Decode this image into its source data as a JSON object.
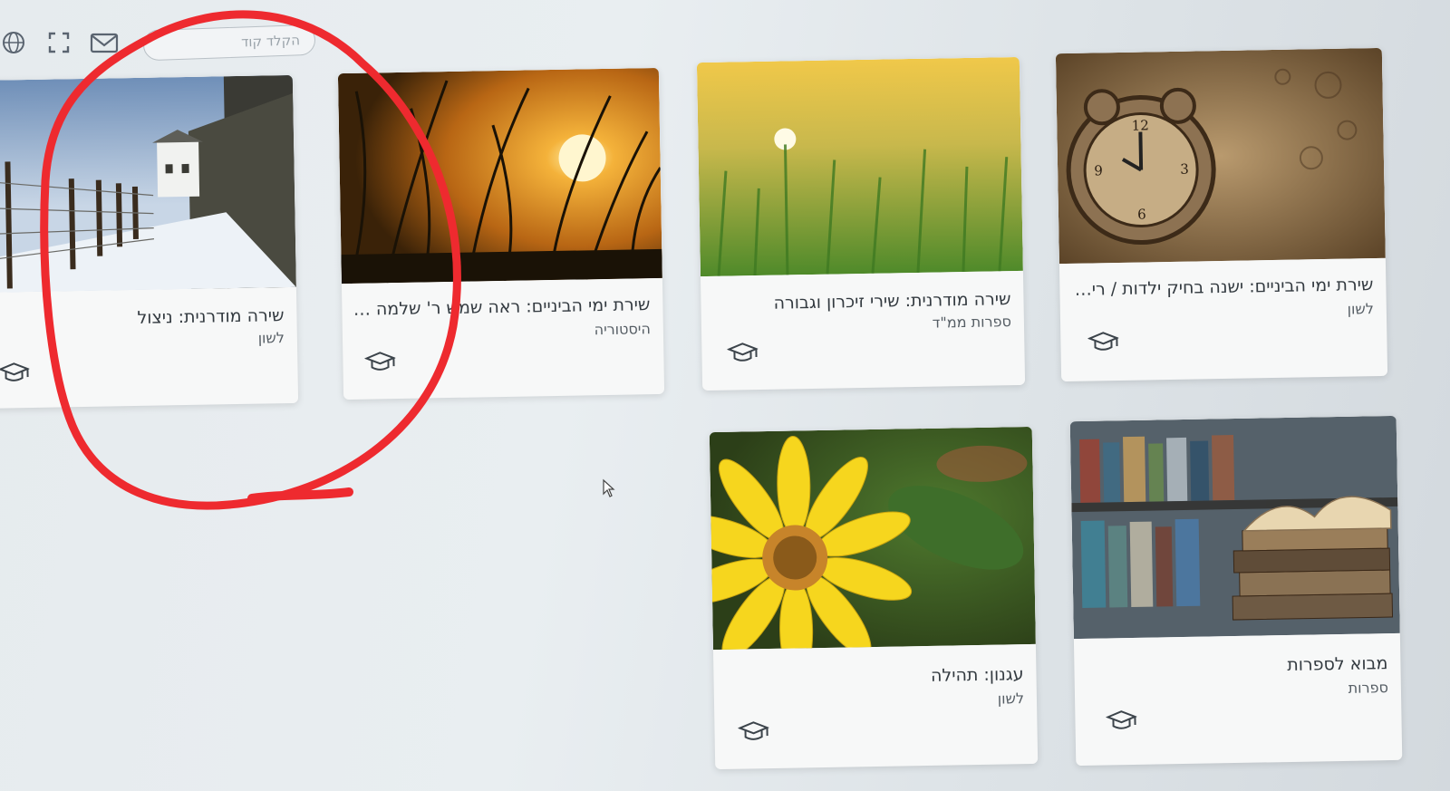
{
  "toolbar": {
    "search_placeholder": "הקלד קוד",
    "icons": [
      "globe-icon",
      "fullscreen-icon",
      "mail-icon"
    ]
  },
  "cards": [
    {
      "title": "שירת ימי הביניים: ישנה בחיק ילדות / רי…",
      "subject": "לשון",
      "image": "antique-clock"
    },
    {
      "title": "שירה מודרנית: שירי זיכרון וגבורה",
      "subject": "ספרות ממ\"ד",
      "image": "wheat-field-sunrise"
    },
    {
      "title": "שירת ימי הביניים: ראה שמש ר' שלמה …",
      "subject": "היסטוריה",
      "image": "sunset-through-grass"
    },
    {
      "title": "שירה מודרנית: ניצול",
      "subject": "לשון",
      "image": "snowy-fence-camp"
    },
    {
      "title": "מבוא לספרות",
      "subject": "ספרות",
      "image": "books-stack"
    },
    {
      "title": "עגנון: תהילה",
      "subject": "לשון",
      "image": "sunflower"
    }
  ],
  "colors": {
    "annotation": "#ee2a2f",
    "card_bg": "#f7f8f8"
  }
}
